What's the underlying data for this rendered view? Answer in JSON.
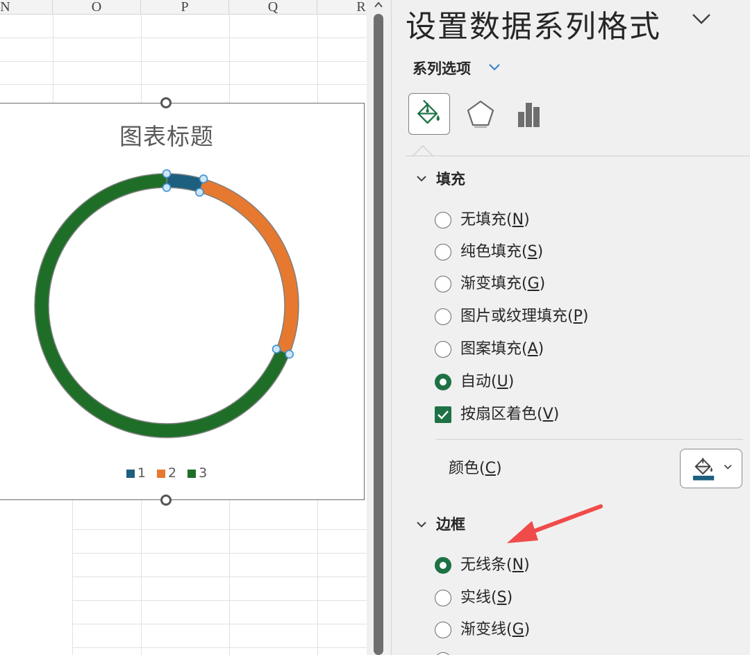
{
  "sheet": {
    "columns": [
      "N",
      "O",
      "P",
      "Q",
      "R"
    ]
  },
  "chart": {
    "title": "图表标题",
    "legend": [
      {
        "label": "1",
        "color": "#1d5f7f"
      },
      {
        "label": "2",
        "color": "#e6792f"
      },
      {
        "label": "3",
        "color": "#1e6e28"
      }
    ]
  },
  "chart_data": {
    "type": "doughnut",
    "title": "图表标题",
    "categories": [
      "1",
      "2",
      "3"
    ],
    "values": [
      4.5,
      26.5,
      69
    ],
    "colors": [
      "#1d5f7f",
      "#e6792f",
      "#1e6e28"
    ],
    "legend_position": "bottom",
    "selected_point": "1"
  },
  "pane": {
    "title": "设置数据系列格式",
    "series_options_label": "系列选项",
    "tabs": [
      "fill-line-icon",
      "pentagon-effects-icon",
      "bar-chart-icon"
    ],
    "fill_section": {
      "heading": "填充",
      "options": [
        {
          "pre": "无填充(",
          "key": "N",
          "post": ")",
          "checked": false
        },
        {
          "pre": "纯色填充(",
          "key": "S",
          "post": ")",
          "checked": false
        },
        {
          "pre": "渐变填充(",
          "key": "G",
          "post": ")",
          "checked": false
        },
        {
          "pre": "图片或纹理填充(",
          "key": "P",
          "post": ")",
          "checked": false
        },
        {
          "pre": "图案填充(",
          "key": "A",
          "post": ")",
          "checked": false
        },
        {
          "pre": "自动(",
          "key": "U",
          "post": ")",
          "checked": true
        }
      ],
      "vary_colors": {
        "pre": "按扇区着色(",
        "key": "V",
        "post": ")",
        "checked": true
      },
      "color": {
        "pre": "颜色(",
        "key": "C",
        "post": ")",
        "swatch": "#1d5f7f"
      }
    },
    "border_section": {
      "heading": "边框",
      "options": [
        {
          "pre": "无线条(",
          "key": "N",
          "post": ")",
          "checked": true
        },
        {
          "pre": "实线(",
          "key": "S",
          "post": ")",
          "checked": false
        },
        {
          "pre": "渐变线(",
          "key": "G",
          "post": ")",
          "checked": false
        }
      ]
    },
    "accent_color": "#1e7145",
    "annotation_arrow_color": "#f04b4b"
  }
}
